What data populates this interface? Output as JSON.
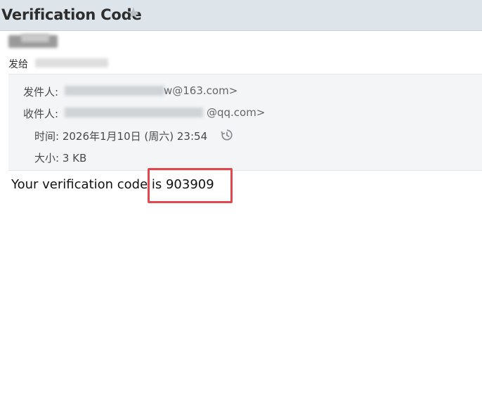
{
  "email": {
    "subject": "Verification Code",
    "star_glyph": "★",
    "sent_to_label": "发给",
    "headers": {
      "from_label": "发件人:",
      "from_address_visible": "w@163.com>",
      "to_label": "收件人:",
      "to_address_visible": "@qq.com>",
      "time_label": "时间:",
      "time_value": "2026年1月10日 (周六) 23:54",
      "size_label": "大小:",
      "size_value": "3 KB"
    },
    "body": {
      "prefix": "Your verification code is ",
      "code": "903909"
    }
  },
  "icons": {
    "star": "star-icon",
    "history": "history-icon"
  },
  "colors": {
    "title_bar_bg": "#dde4ea",
    "detail_panel_bg": "#f3f5f7",
    "highlight_border": "#e0484d"
  }
}
